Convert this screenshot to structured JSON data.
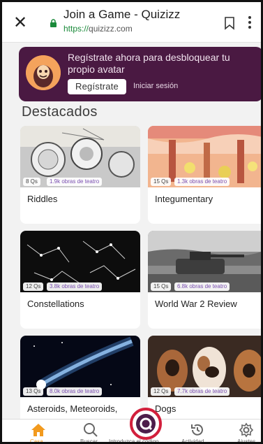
{
  "browser": {
    "title": "Join a Game - Quizizz",
    "url_scheme": "https://",
    "url_host": "quizizz.com",
    "close_icon": "close-icon",
    "lock_icon": "lock-icon",
    "bookmark_icon": "bookmark-icon",
    "more_icon": "more-vert-icon"
  },
  "promo": {
    "text": "Regístrate ahora para desbloquear tu propio avatar",
    "register_label": "Regístrate",
    "login_label": "Iniciar sesión",
    "background": "#4a1942"
  },
  "section": {
    "title": "Destacados"
  },
  "cards": [
    {
      "title": "Riddles",
      "questions": "8 Qs",
      "plays": "1.9k obras de teatro"
    },
    {
      "title": "Integumentary",
      "questions": "15 Qs",
      "plays": "1.3k obras de teatro"
    },
    {
      "title": "Constellations",
      "questions": "12 Qs",
      "plays": "3.8k obras de teatro"
    },
    {
      "title": "World War 2 Review",
      "questions": "15 Qs",
      "plays": "6.8k obras de teatro"
    },
    {
      "title": "Asteroids, Meteoroids,",
      "questions": "13 Qs",
      "plays": "8.0k obras de teatro"
    },
    {
      "title": "Dogs",
      "questions": "12 Qs",
      "plays": "7.7k obras de teatro"
    }
  ],
  "nav": {
    "home_label": "Casa",
    "search_label": "Buscar",
    "join_label": "Introduzca el código",
    "activity_label": "Actividad",
    "settings_label": "Ajustes",
    "accent": "#f29a1e",
    "join_ring": "#d21f3c"
  }
}
